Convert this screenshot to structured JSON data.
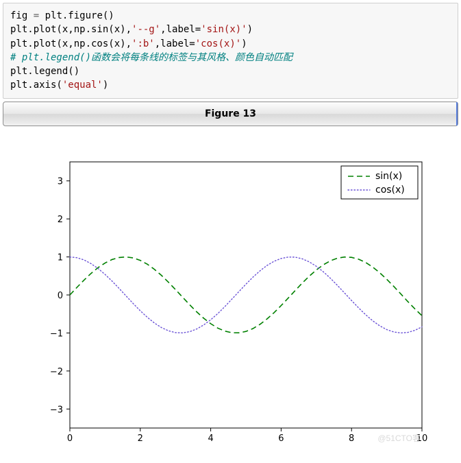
{
  "code": {
    "l1_a": "fig ",
    "l1_eq": "=",
    "l1_b": " plt.figure()",
    "l2_a": "plt.plot(x,np.sin(x),",
    "l2_s1": "'--g'",
    "l2_b": ",label=",
    "l2_s2": "'sin(x)'",
    "l2_c": ")",
    "l3_a": "plt.plot(x,np.cos(x),",
    "l3_s1": "':b'",
    "l3_b": ",label=",
    "l3_s2": "'cos(x)'",
    "l3_c": ")",
    "l4_comment": "# plt.legend()函数会将每条线的标签与其风格、颜色自动匹配",
    "l5": "plt.legend()",
    "l6_a": "plt.axis(",
    "l6_s": "'equal'",
    "l6_b": ")"
  },
  "figure_title": "Figure 13",
  "watermark": "@51CTO客",
  "legend": {
    "sin": "sin(x)",
    "cos": "cos(x)"
  },
  "ticks": {
    "x": [
      "0",
      "2",
      "4",
      "6",
      "8",
      "10"
    ],
    "y": [
      "−3",
      "−2",
      "−1",
      "0",
      "1",
      "2",
      "3"
    ]
  },
  "chart_data": {
    "type": "line",
    "title": "",
    "xlabel": "",
    "ylabel": "",
    "xlim": [
      0,
      10
    ],
    "ylim": [
      -3.5,
      3.5
    ],
    "x": [
      0,
      0.2,
      0.4,
      0.6,
      0.8,
      1,
      1.2,
      1.4,
      1.6,
      1.8,
      2,
      2.2,
      2.4,
      2.6,
      2.8,
      3,
      3.2,
      3.4,
      3.6,
      3.8,
      4,
      4.2,
      4.4,
      4.6,
      4.8,
      5,
      5.2,
      5.4,
      5.6,
      5.8,
      6,
      6.2,
      6.4,
      6.6,
      6.8,
      7,
      7.2,
      7.4,
      7.6,
      7.8,
      8,
      8.2,
      8.4,
      8.6,
      8.8,
      9,
      9.2,
      9.4,
      9.6,
      9.8,
      10
    ],
    "series": [
      {
        "name": "sin(x)",
        "style": "--",
        "color": "#008000",
        "values": [
          0,
          0.1987,
          0.3894,
          0.5646,
          0.7174,
          0.8415,
          0.932,
          0.9854,
          0.9996,
          0.9738,
          0.9093,
          0.8085,
          0.6755,
          0.5155,
          0.335,
          0.1411,
          -0.0584,
          -0.2555,
          -0.4425,
          -0.6119,
          -0.7568,
          -0.8716,
          -0.9516,
          -0.9937,
          -0.9962,
          -0.9589,
          -0.8835,
          -0.7728,
          -0.6313,
          -0.4646,
          -0.2794,
          -0.0831,
          0.1165,
          0.3115,
          0.494,
          0.657,
          0.7937,
          0.8987,
          0.9679,
          0.9985,
          0.9894,
          0.9407,
          0.8546,
          0.7344,
          0.585,
          0.4121,
          0.2229,
          0.0248,
          -0.1743,
          -0.3665,
          -0.544
        ]
      },
      {
        "name": "cos(x)",
        "style": ":",
        "color": "#6a52d6",
        "values": [
          1,
          0.9801,
          0.9211,
          0.8253,
          0.6967,
          0.5403,
          0.3624,
          0.17,
          -0.0292,
          -0.2272,
          -0.4161,
          -0.5885,
          -0.7374,
          -0.8569,
          -0.9422,
          -0.99,
          -0.9983,
          -0.9668,
          -0.8968,
          -0.791,
          -0.6536,
          -0.4903,
          -0.3073,
          -0.1122,
          0.0875,
          0.2837,
          0.4685,
          0.6347,
          0.7756,
          0.8855,
          0.9602,
          0.9965,
          0.9932,
          0.9502,
          0.8694,
          0.7539,
          0.6084,
          0.4385,
          0.2513,
          0.0541,
          -0.1455,
          -0.3392,
          -0.5193,
          -0.6787,
          -0.8111,
          -0.9111,
          -0.9748,
          -0.9997,
          -0.9847,
          -0.9304,
          -0.8391
        ]
      }
    ],
    "legend_position": "upper right",
    "grid": false
  }
}
